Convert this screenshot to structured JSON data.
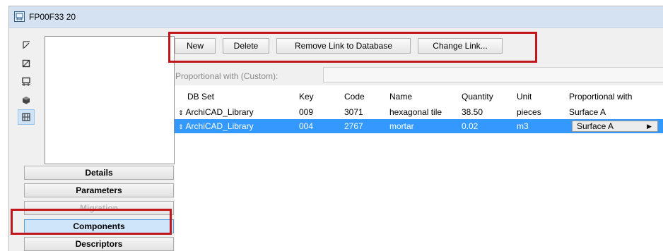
{
  "window": {
    "title": "FP00F33 20"
  },
  "toolbar": {
    "new_label": "New",
    "delete_label": "Delete",
    "remove_link_label": "Remove Link to Database",
    "change_link_label": "Change Link..."
  },
  "proportional": {
    "label": "Proportional with (Custom):",
    "value": ""
  },
  "sidebar": {
    "tools": [
      {
        "icon": "floor-plan-icon"
      },
      {
        "icon": "section-icon"
      },
      {
        "icon": "elevation-icon"
      },
      {
        "icon": "3d-view-icon"
      },
      {
        "icon": "component-icon"
      }
    ],
    "buttons": [
      {
        "label": "Details",
        "state": "normal"
      },
      {
        "label": "Parameters",
        "state": "normal"
      },
      {
        "label": "Migration",
        "state": "disabled"
      },
      {
        "label": "Components",
        "state": "active"
      },
      {
        "label": "Descriptors",
        "state": "normal"
      }
    ]
  },
  "table": {
    "columns": [
      "DB Set",
      "Key",
      "Code",
      "Name",
      "Quantity",
      "Unit",
      "Proportional with"
    ],
    "rows": [
      {
        "db_set": "ArchiCAD_Library",
        "key": "009",
        "code": "3071",
        "name": "hexagonal tile",
        "quantity": "38.50",
        "unit": "pieces",
        "proportional": "Surface A",
        "selected": false
      },
      {
        "db_set": "ArchiCAD_Library",
        "key": "004",
        "code": "2767",
        "name": "mortar",
        "quantity": "0.02",
        "unit": "m3",
        "proportional": "Surface A",
        "selected": true
      }
    ]
  },
  "colors": {
    "selection": "#3399ff",
    "highlight": "#c0161c",
    "titlebar": "#d4e2f1"
  }
}
